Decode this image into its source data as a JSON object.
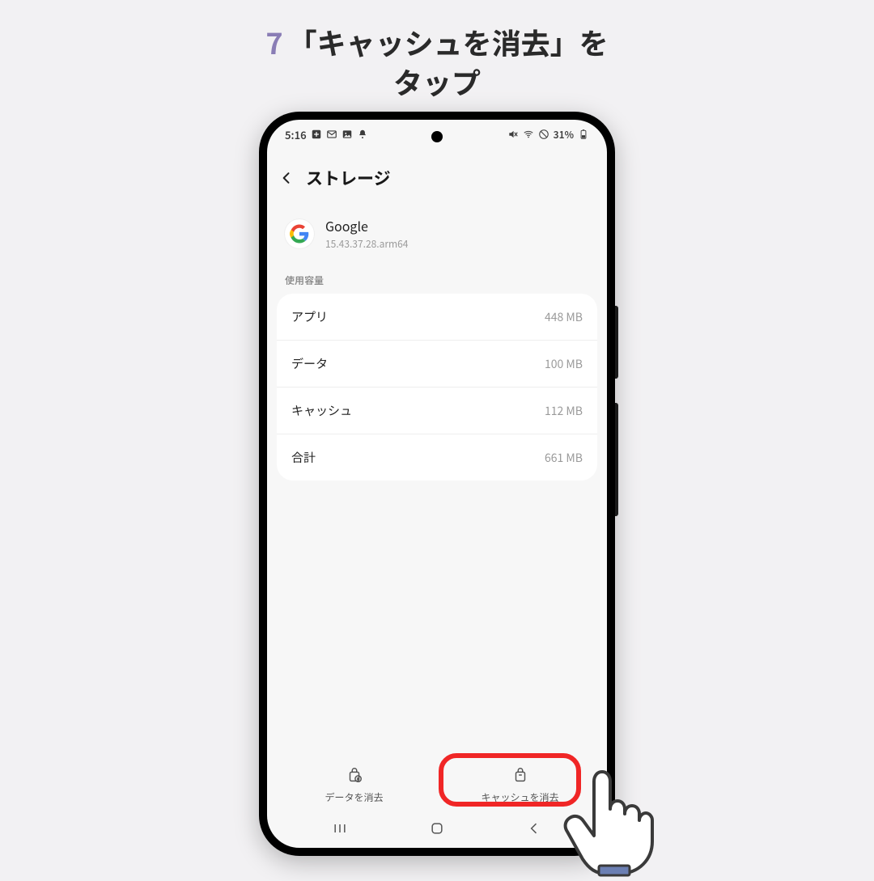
{
  "instruction": {
    "step_number": "7",
    "line1": "「キャッシュを消去」を",
    "line2": "タップ"
  },
  "status_bar": {
    "time": "5:16",
    "battery_text": "31%"
  },
  "header": {
    "title": "ストレージ"
  },
  "app": {
    "name": "Google",
    "version": "15.43.37.28.arm64"
  },
  "usage": {
    "section_label": "使用容量",
    "rows": [
      {
        "label": "アプリ",
        "value": "448 MB"
      },
      {
        "label": "データ",
        "value": "100 MB"
      },
      {
        "label": "キャッシュ",
        "value": "112 MB"
      },
      {
        "label": "合計",
        "value": "661 MB"
      }
    ]
  },
  "actions": {
    "clear_data": "データを消去",
    "clear_cache": "キャッシュを消去"
  }
}
